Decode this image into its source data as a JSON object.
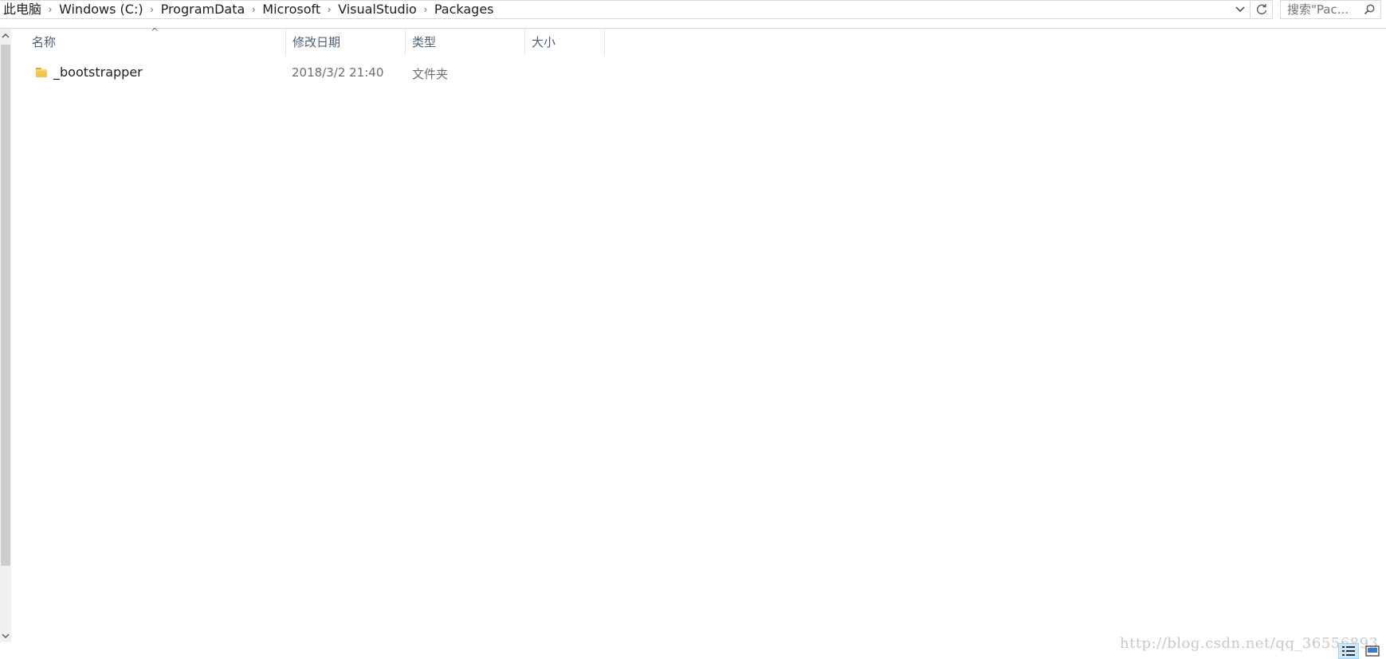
{
  "address_bar": {
    "crumbs": [
      "此电脑",
      "Windows (C:)",
      "ProgramData",
      "Microsoft",
      "VisualStudio",
      "Packages"
    ]
  },
  "search": {
    "placeholder": "搜索\"Pac..."
  },
  "columns": {
    "name": "名称",
    "date": "修改日期",
    "type": "类型",
    "size": "大小"
  },
  "files": [
    {
      "name": "_bootstrapper",
      "modified": "2018/3/2 21:40",
      "type": "文件夹",
      "size": "",
      "icon": "folder-icon"
    }
  ],
  "watermark": "http://blog.csdn.net/qq_36556893",
  "colors": {
    "header_text": "#4c607a",
    "folder": "#f5c54a",
    "selected_view": "#cce8ff"
  }
}
